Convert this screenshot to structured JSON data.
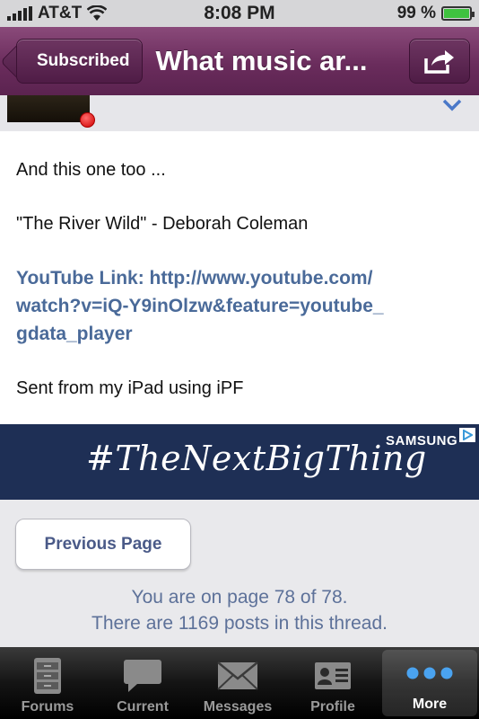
{
  "status_bar": {
    "carrier": "AT&T",
    "time": "8:08 PM",
    "battery": "99 %",
    "battery_level": 0.99
  },
  "nav": {
    "back_label": "Subscribed",
    "title": "What music ar..."
  },
  "post": {
    "lines": [
      "And this one too ...",
      "\"The River Wild\" - Deborah Coleman",
      "Sent from my iPad using iPF"
    ],
    "link_lines": [
      "YouTube Link: http://www.youtube.com/",
      "watch?v=iQ-Y9inOlzw&feature=youtube_",
      "gdata_player"
    ]
  },
  "ad": {
    "text": "#TheNextBigThing",
    "brand": "SAMSUNG"
  },
  "pager": {
    "prev_label": "Previous Page",
    "page_status": "You are on page 78 of 78.",
    "post_count": "There are 1169 posts in this thread."
  },
  "tabs": [
    {
      "label": "Forums",
      "icon": "cabinet-icon",
      "active": false
    },
    {
      "label": "Current",
      "icon": "chat-bubble-icon",
      "active": false
    },
    {
      "label": "Messages",
      "icon": "envelope-icon",
      "active": false
    },
    {
      "label": "Profile",
      "icon": "profile-card-icon",
      "active": false
    },
    {
      "label": "More",
      "icon": "more-dots-icon",
      "active": true
    }
  ],
  "colors": {
    "nav_bar": "#6a2c5c",
    "link": "#4a6a99",
    "ad_background": "#1e2f55"
  }
}
